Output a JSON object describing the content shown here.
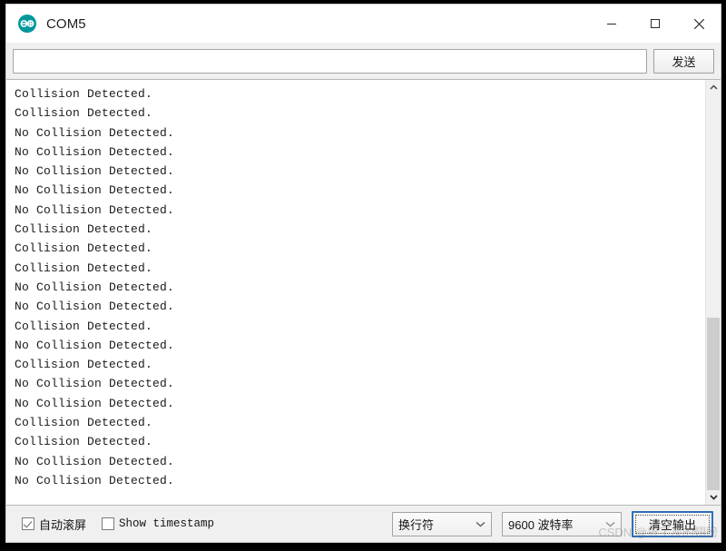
{
  "window": {
    "title": "COM5",
    "app_icon": "arduino-logo-icon",
    "accent_color": "#00979c",
    "controls": {
      "minimize": "minimize-icon",
      "maximize": "maximize-icon",
      "close": "close-icon"
    }
  },
  "send_row": {
    "input_value": "",
    "input_placeholder": "",
    "send_label": "发送"
  },
  "console": {
    "lines": [
      "Collision Detected.",
      "Collision Detected.",
      "No Collision Detected.",
      "No Collision Detected.",
      "No Collision Detected.",
      "No Collision Detected.",
      "No Collision Detected.",
      "Collision Detected.",
      "Collision Detected.",
      "Collision Detected.",
      "No Collision Detected.",
      "No Collision Detected.",
      "Collision Detected.",
      "No Collision Detected.",
      "Collision Detected.",
      "No Collision Detected.",
      "No Collision Detected.",
      "Collision Detected.",
      "Collision Detected.",
      "No Collision Detected.",
      "No Collision Detected."
    ]
  },
  "scrollbar": {
    "up_arrow": "chevron-up-icon",
    "down_arrow": "chevron-down-icon"
  },
  "statusbar": {
    "autoscroll_label": "自动滚屏",
    "autoscroll_checked": true,
    "timestamp_label": "Show timestamp",
    "timestamp_checked": false,
    "newline_value": "换行符",
    "baud_value": "9600 波特率",
    "clear_label": "清空输出"
  },
  "watermark": {
    "text": "CSDN @折了灰的翅膀"
  }
}
